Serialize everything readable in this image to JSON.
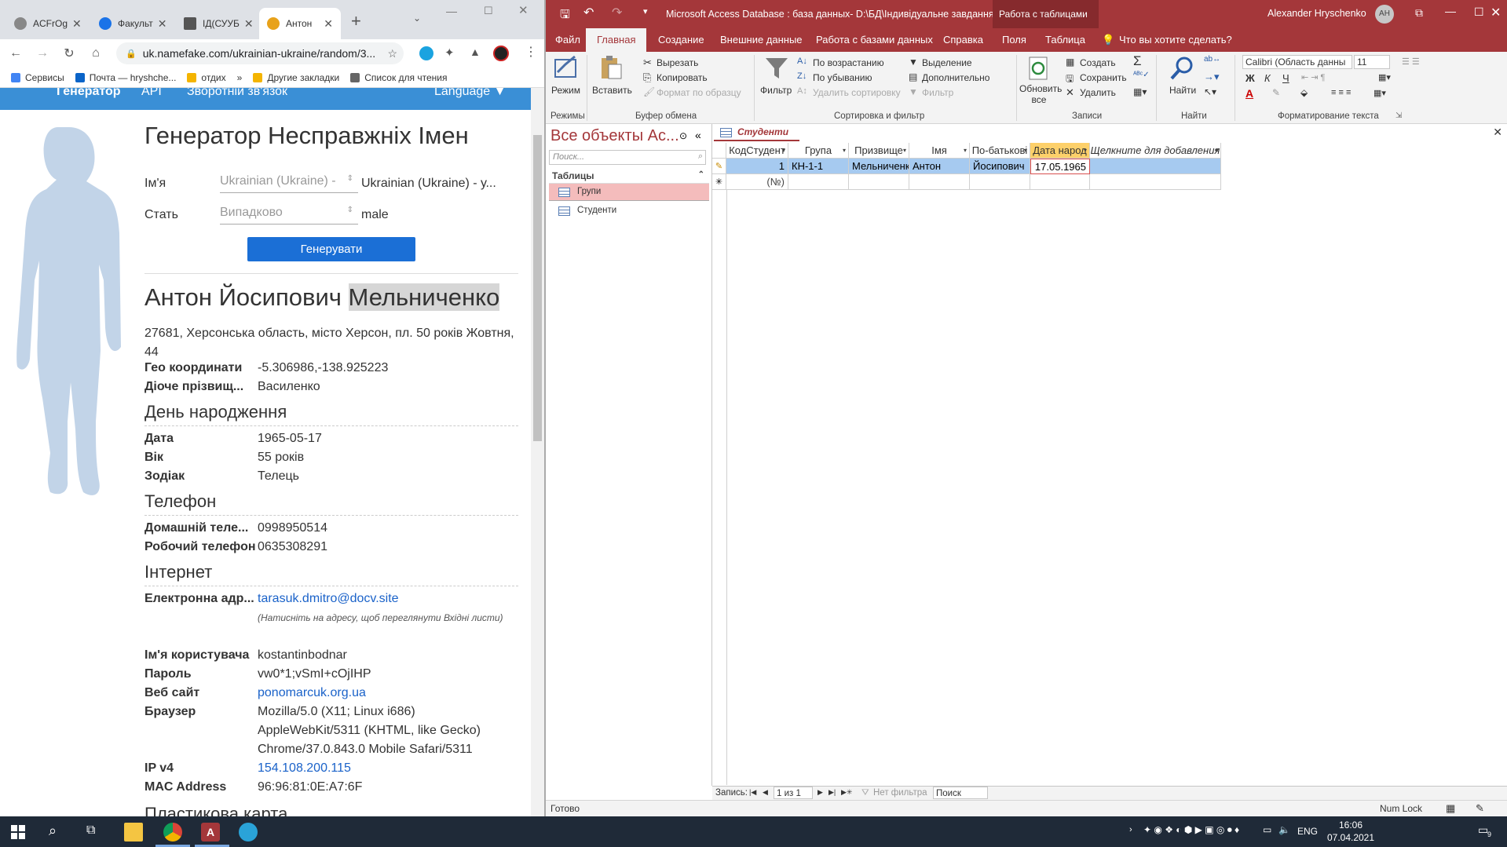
{
  "browser": {
    "tabs": [
      {
        "title": "ACFrOg",
        "fav_color": "#666"
      },
      {
        "title": "Факульт",
        "fav_color": "#1a73e8"
      },
      {
        "title": "ІД(СУУБ",
        "fav_color": "#555"
      },
      {
        "title": "Антон",
        "fav_color": "#e8a21a"
      }
    ],
    "url": "uk.namefake.com/ukrainian-ukraine/random/3...",
    "bookmarks": [
      "Сервисы",
      "Почта — hryshche...",
      "отдих",
      "»",
      "Другие закладки",
      "Список для чтения"
    ]
  },
  "site": {
    "nav": [
      "Генератор",
      "API",
      "Зворотній зв'язок",
      "Language ▼"
    ],
    "title": "Генератор Несправжніх Імен",
    "form": {
      "name_label": "Ім'я",
      "name_select": "Ukrainian (Ukraine) -",
      "name_value": "Ukrainian (Ukraine) - у...",
      "gender_label": "Стать",
      "gender_select": "Випадково",
      "gender_value": "male",
      "button": "Генерувати"
    },
    "person": {
      "first": "Антон Йосипович",
      "last": "Мельниченко",
      "address": "27681, Херсонська область, місто Херсон, пл. 50 років Жовтня, 44",
      "geo_label": "Гео координати",
      "geo_value": "-5.306986,-138.925223",
      "maiden_label": "Діоче прізвищ...",
      "maiden_value": "Василенко"
    },
    "birthday": {
      "title": "День народження",
      "date_label": "Дата",
      "date_value": "1965-05-17",
      "age_label": "Вік",
      "age_value": "55 років",
      "zodiac_label": "Зодіак",
      "zodiac_value": "Телець"
    },
    "phone": {
      "title": "Телефон",
      "home_label": "Домашній теле...",
      "home_value": "0998950514",
      "work_label": "Робочий телефон",
      "work_value": "0635308291"
    },
    "internet": {
      "title": "Інтернет",
      "email_label": "Електронна адр...",
      "email_value": "tarasuk.dmitro@docv.site",
      "email_note": "(Натисніть на адресу, щоб переглянути Вхідні листи)",
      "user_label": "Ім'я користувача",
      "user_value": "kostantinbodnar",
      "pass_label": "Пароль",
      "pass_value": "vw0*1;vSmI+cOjIHP",
      "site_label": "Веб сайт",
      "site_value": "ponomarcuk.org.ua",
      "browser_label": "Браузер",
      "browser_l1": "Mozilla/5.0 (X11; Linux i686)",
      "browser_l2": "AppleWebKit/5311 (KHTML, like Gecko)",
      "browser_l3": "Chrome/37.0.843.0 Mobile Safari/5311",
      "ip_label": "IP v4",
      "ip_value": "154.108.200.115",
      "mac_label": "MAC Address",
      "mac_value": "96:96:81:0E:A7:6F",
      "next_section": "Пластикова карта"
    }
  },
  "access": {
    "title": "Microsoft Access Database : база данных- D:\\БД\\Індивідуальне завдання...",
    "context_tab": "Работа с таблицами",
    "user": "Alexander Hryschenko",
    "user_initials": "AH",
    "tabs": [
      "Файл",
      "Главная",
      "Создание",
      "Внешние данные",
      "Работа с базами данных",
      "Справка",
      "Поля",
      "Таблица"
    ],
    "tell_me": "Что вы хотите сделать?",
    "ribbon": {
      "mode": "Режим",
      "paste": "Вставить",
      "cut": "Вырезать",
      "copy": "Копировать",
      "format_painter": "Формат по образцу",
      "filter": "Фильтр",
      "asc": "По возрастанию",
      "desc": "По убыванию",
      "remove_sort": "Удалить сортировку",
      "selection": "Выделение",
      "advanced": "Дополнительно",
      "toggle_filter": "Фильтр",
      "refresh": "Обновить все",
      "new": "Создать",
      "save": "Сохранить",
      "delete": "Удалить",
      "find": "Найти",
      "font": "Calibri (Область данны",
      "size": "11",
      "groups": [
        "Режимы",
        "Буфер обмена",
        "Сортировка и фильтр",
        "Записи",
        "Найти",
        "Форматирование текста"
      ]
    },
    "nav": {
      "title": "Все объекты Ac...",
      "search": "Поиск...",
      "category": "Таблицы",
      "items": [
        "Групи",
        "Студенти"
      ]
    },
    "doc_tab": "Студенти",
    "columns": [
      "КодСтудент",
      "Група",
      "Призвище",
      "Імя",
      "По-батькові",
      "Дата народ",
      "Щелкните для добавления"
    ],
    "rows": [
      [
        "1",
        "КН-1-1",
        "Мельниченко",
        "Антон",
        "Йосипович",
        "17.05.1965"
      ]
    ],
    "new_row": "(№)",
    "record_nav": {
      "label": "Запись:",
      "pos": "1 из 1",
      "filter": "Нет фильтра",
      "search": "Поиск"
    },
    "status": {
      "left": "Готово",
      "right": "Num Lock"
    }
  },
  "taskbar": {
    "lang": "ENG",
    "time": "16:06",
    "date": "07.04.2021",
    "notif": "9"
  }
}
